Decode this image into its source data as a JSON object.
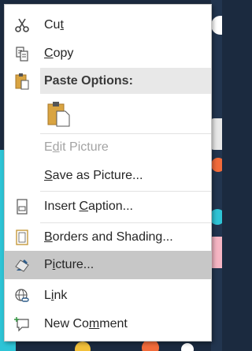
{
  "menu": {
    "cut": {
      "pre": "Cu",
      "acc": "t",
      "post": ""
    },
    "copy": {
      "pre": "",
      "acc": "C",
      "post": "opy"
    },
    "paste_options": "Paste Options:",
    "edit_picture": {
      "pre": "E",
      "acc": "d",
      "post": "it Picture"
    },
    "save_as_picture": {
      "pre": "",
      "acc": "S",
      "post": "ave as Picture..."
    },
    "insert_caption": {
      "pre": "Insert ",
      "acc": "C",
      "post": "aption..."
    },
    "borders_shading": {
      "pre": "",
      "acc": "B",
      "post": "orders and Shading..."
    },
    "picture": {
      "pre": "P",
      "acc": "i",
      "post": "cture..."
    },
    "link": {
      "pre": "L",
      "acc": "i",
      "post": "nk"
    },
    "new_comment": {
      "pre": "New Co",
      "acc": "m",
      "post": "ment"
    }
  },
  "icons": {
    "cut": "scissors-icon",
    "copy": "copy-icon",
    "paste": "clipboard-icon",
    "paste_keep_formatting": "paste-picture-icon",
    "insert_caption": "caption-icon",
    "borders_shading": "page-border-icon",
    "picture": "format-picture-icon",
    "link": "globe-link-icon",
    "new_comment": "new-comment-icon"
  },
  "colors": {
    "highlight": "#c7c7c7",
    "header_bg": "#e8e8e8",
    "disabled_text": "#a3a3a3",
    "text": "#262626"
  }
}
